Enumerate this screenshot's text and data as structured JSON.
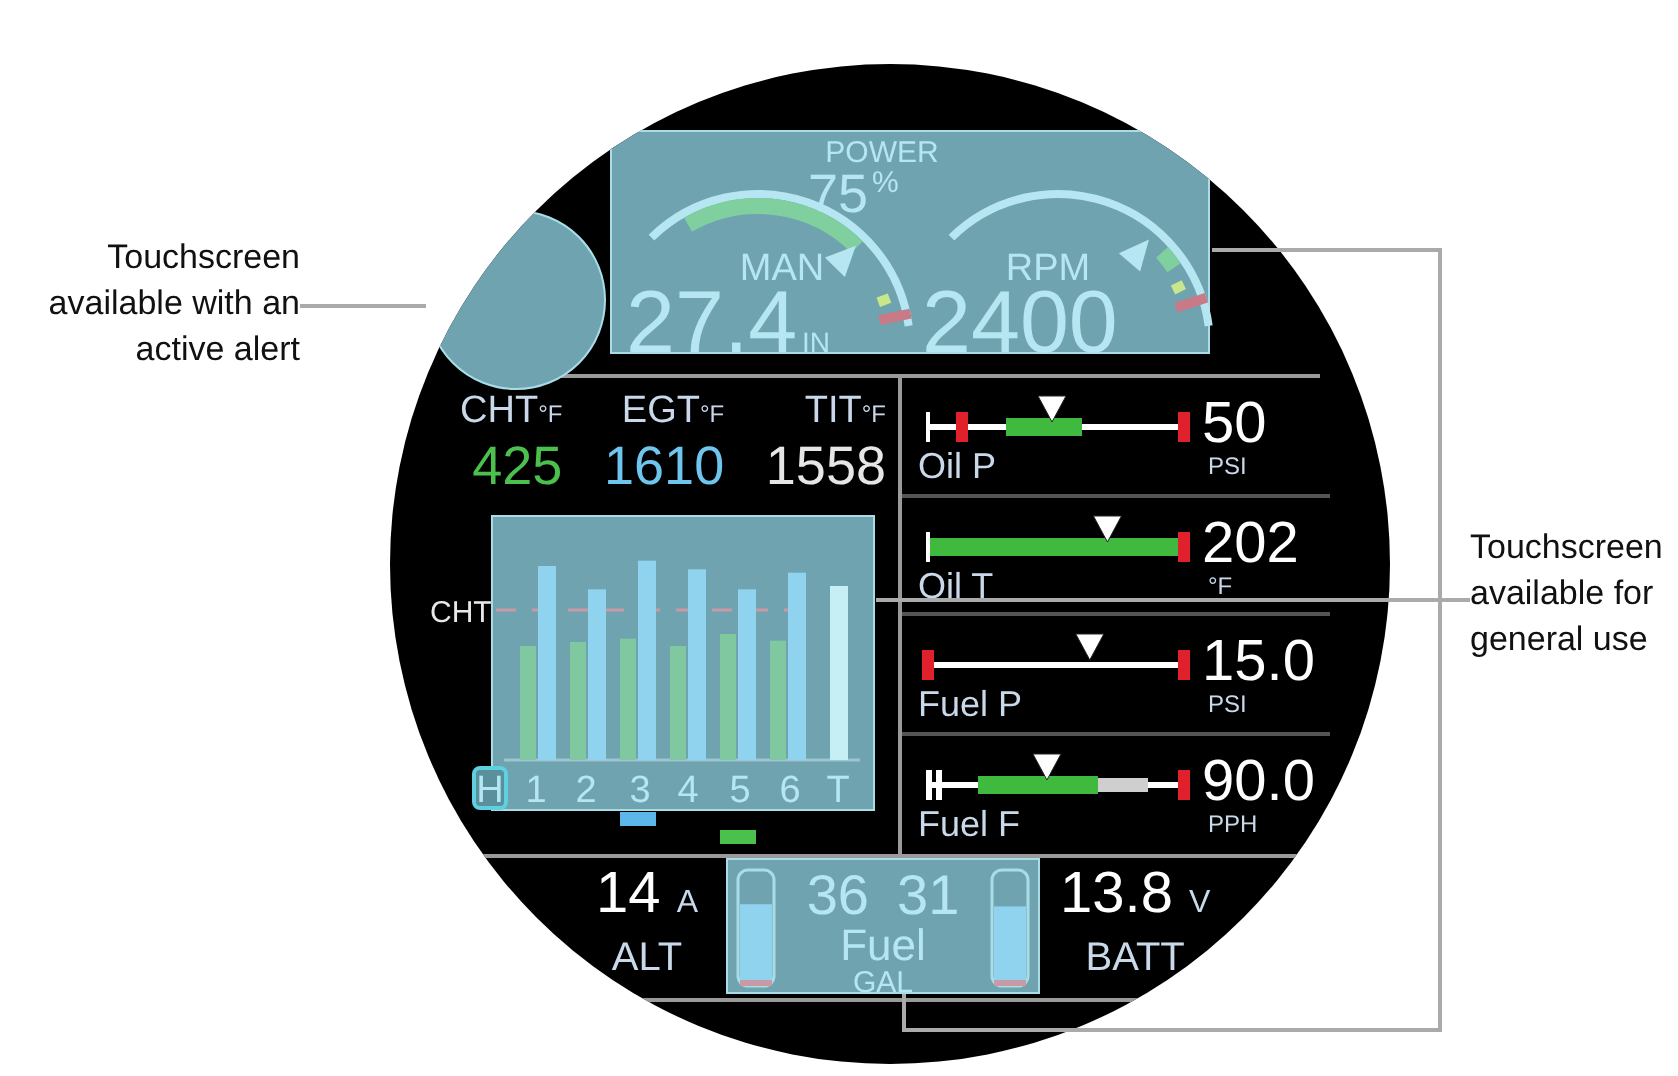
{
  "callouts": {
    "left": [
      "Touchscreen",
      "available with an",
      "active alert"
    ],
    "right": [
      "Touchscreen",
      "available for",
      "general use"
    ]
  },
  "power": {
    "label": "POWER",
    "value": "75",
    "unit": "%"
  },
  "dials": [
    {
      "label": "MAN",
      "value": "27.4",
      "unit": "IN",
      "level": 0.7
    },
    {
      "label": "RPM",
      "value": "2400",
      "level": 0.67
    }
  ],
  "temps": [
    {
      "label": "CHT",
      "unit": "°F",
      "value": "425",
      "color": "#4cc04c"
    },
    {
      "label": "EGT",
      "unit": "°F",
      "value": "1610",
      "color": "#6ec6ee"
    },
    {
      "label": "TIT",
      "unit": "°F",
      "value": "1558",
      "color": "#e6e6e6"
    }
  ],
  "cylinders": {
    "reference_label": "CHT",
    "labels": [
      {
        "text": "H",
        "highlighted": true
      },
      {
        "text": "1",
        "highlighted": false
      },
      {
        "text": "2",
        "highlighted": false
      },
      {
        "text": "3",
        "highlighted": false
      },
      {
        "text": "4",
        "highlighted": false
      },
      {
        "text": "5",
        "highlighted": false
      },
      {
        "text": "6",
        "highlighted": false
      },
      {
        "text": "T",
        "highlighted": false
      }
    ]
  },
  "engine_bars": [
    {
      "label": "Oil P",
      "value": "50",
      "unit": "PSI",
      "level": 0.5
    },
    {
      "label": "Oil T",
      "value": "202",
      "unit": "°F",
      "level": 0.72
    },
    {
      "label": "Fuel P",
      "value": "15.0",
      "unit": "PSI",
      "level": 0.65
    },
    {
      "label": "Fuel F",
      "value": "90.0",
      "unit": "PPH",
      "level": 0.48
    }
  ],
  "alt": {
    "value": "14",
    "unit": "A",
    "label": "ALT"
  },
  "fuel": {
    "label": "Fuel",
    "unit": "GAL",
    "tanks": [
      {
        "value": "36",
        "level": 0.72
      },
      {
        "value": "31",
        "level": 0.7
      }
    ]
  },
  "batt": {
    "value": "13.8",
    "unit": "V",
    "label": "BATT"
  }
}
